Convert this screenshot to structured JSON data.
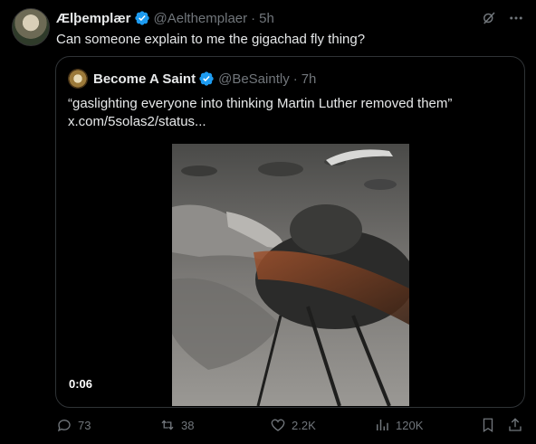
{
  "post": {
    "author_name": "Ælþemplær",
    "author_handle": "@Aelthemplaer",
    "separator": "·",
    "time": "5h",
    "text": "Can someone explain to me the gigachad fly thing?"
  },
  "quoted": {
    "author_name": "Become A Saint",
    "author_handle": "@BeSaintly",
    "separator": "·",
    "time": "7h",
    "text_line1": "“gaslighting everyone into thinking Martin Luther removed them”",
    "text_line2": "x.com/5solas2/status...",
    "video_duration": "0:06"
  },
  "stats": {
    "replies": "73",
    "reposts": "38",
    "likes": "2.2K",
    "views": "120K"
  },
  "icons": {
    "verified": "verified-badge-icon",
    "grok": "grok-icon",
    "more": "more-icon",
    "reply": "reply-icon",
    "repost": "repost-icon",
    "like": "heart-icon",
    "views": "views-icon",
    "bookmark": "bookmark-icon",
    "share": "share-icon"
  },
  "colors": {
    "background": "#000000",
    "text": "#e7e9ea",
    "muted": "#71767b",
    "verified": "#1d9bf0",
    "border": "#2f3336"
  }
}
